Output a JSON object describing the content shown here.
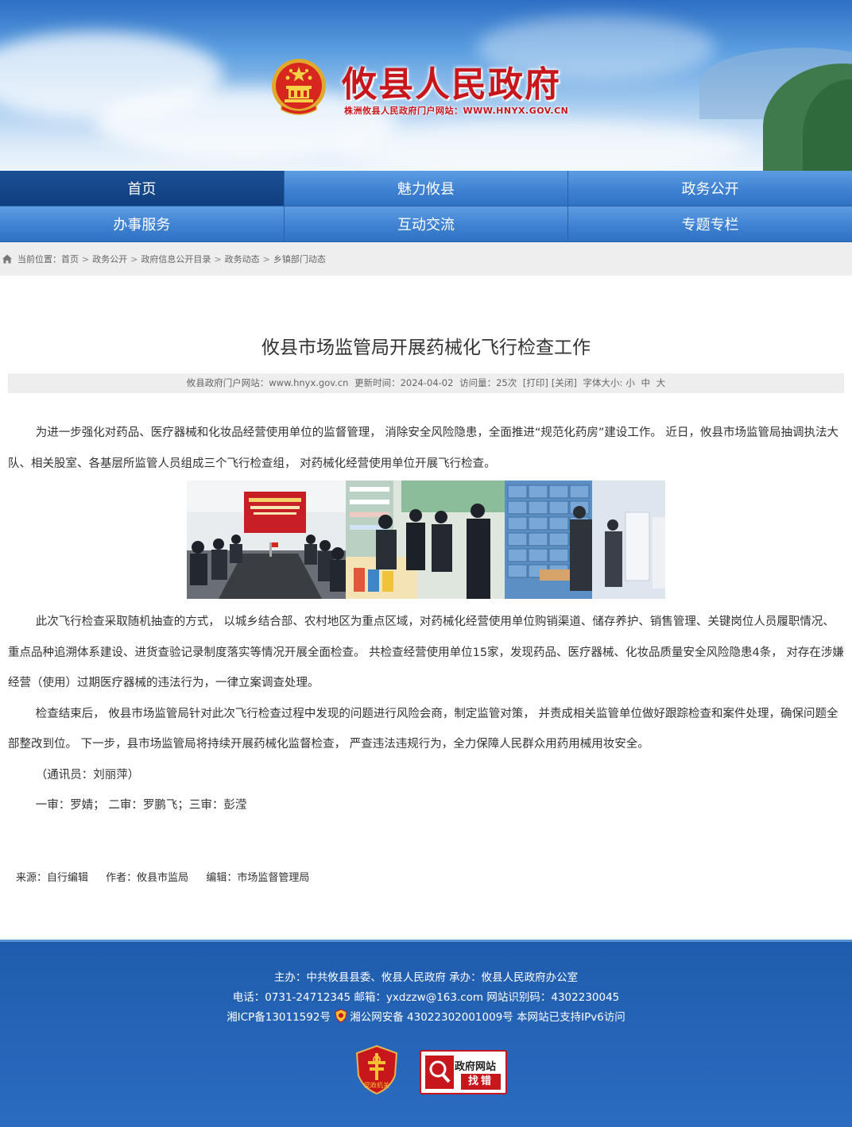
{
  "header": {
    "site_title": "攸县人民政府",
    "site_subtitle": "株洲攸县人民政府门户网站：WWW.HNYX.GOV.CN"
  },
  "nav": {
    "row1": [
      {
        "label": "首页",
        "active": true
      },
      {
        "label": "魅力攸县",
        "active": false
      },
      {
        "label": "政务公开",
        "active": false
      }
    ],
    "row2": [
      {
        "label": "办事服务",
        "active": false
      },
      {
        "label": "互动交流",
        "active": false
      },
      {
        "label": "专题专栏",
        "active": false
      }
    ]
  },
  "breadcrumb": {
    "prefix": "当前位置：",
    "items": [
      "首页",
      "政务公开",
      "政府信息公开目录",
      "政务动态",
      "乡镇部门动态"
    ],
    "separator": ">"
  },
  "article": {
    "title": "攸县市场监管局开展药械化飞行检查工作",
    "meta": {
      "site": "攸县政府门户网站：www.hnyx.gov.cn",
      "updated": "更新时间：2024-04-02",
      "views": "访问量：25次",
      "print": "[打印]",
      "close": "[关闭]",
      "font_size_label": "字体大小:",
      "font_small": "小",
      "font_medium": "中",
      "font_large": "大"
    },
    "paragraphs": {
      "p1": "为进一步强化对药品、医疗器械和化妆品经营使用单位的监督管理， 消除安全风险隐患，全面推进“规范化药房”建设工作。 近日，攸县市场监管局抽调执法大队、相关股室、各基层所监管人员组成三个飞行检查组， 对药械化经营使用单位开展飞行检查。",
      "p2": "此次飞行检查采取随机抽查的方式， 以城乡结合部、农村地区为重点区域，对药械化经营使用单位购销渠道、储存养护、销售管理、关键岗位人员履职情况、重点品种追溯体系建设、进货查验记录制度落实等情况开展全面检查。 共检查经营使用单位15家，发现药品、医疗器械、化妆品质量安全风险隐患4条， 对存在涉嫌经营（使用）过期医疗器械的违法行为，一律立案调查处理。",
      "p3": "检查结束后， 攸县市场监管局针对此次飞行检查过程中发现的问题进行风险会商，制定监管对策， 并责成相关监管单位做好跟踪检查和案件处理，确保问题全部整改到位。 下一步，县市场监管局将持续开展药械化监督检查， 严查违法违规行为，全力保障人民群众用药用械用妆安全。",
      "p4": "（通讯员：刘丽萍）",
      "p5": "一审：罗婧； 二审：罗鹏飞；三审：彭滢"
    },
    "source": {
      "from": "来源：自行编辑",
      "author": "作者：攸县市监局",
      "editor": "编辑：市场监督管理局"
    }
  },
  "footer": {
    "line1": "主办：中共攸县县委、攸县人民政府 承办：攸县人民政府办公室",
    "line2": "电话：0731-24712345  邮箱：yxdzzw@163.com  网站识别码：4302230045",
    "line3_icp": "湘ICP备13011592号",
    "line3_police": "湘公网安备 43022302001009号",
    "line3_ipv6": "本网站已支持IPv6访问",
    "party_badge_text": "党政机关",
    "error_badge_top": "政府网站",
    "error_badge_bottom": "找错"
  },
  "colors": {
    "title_red": "#c8161d",
    "nav_blue": "#3f82d2",
    "nav_active": "#103f7e",
    "footer_blue": "#2b6cc0"
  }
}
